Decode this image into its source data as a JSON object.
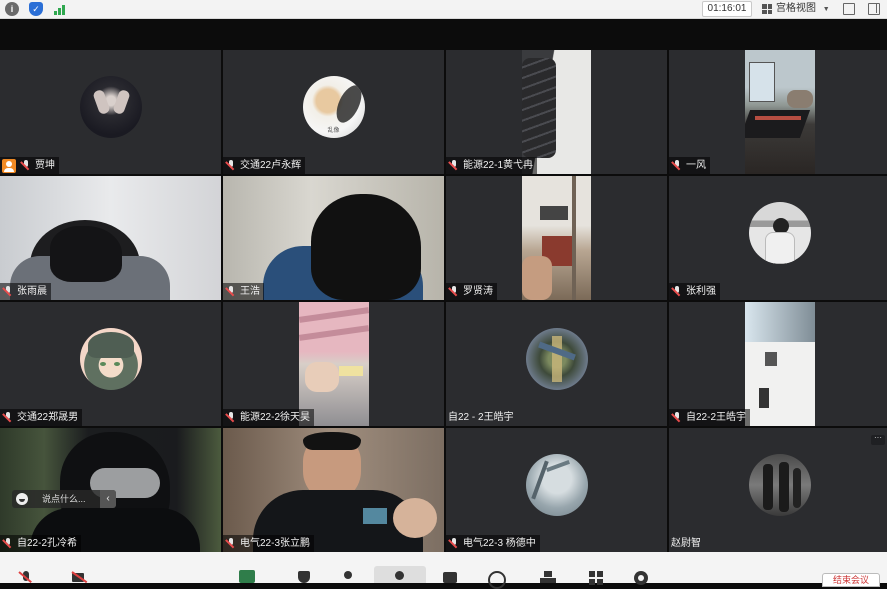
{
  "toolbar": {
    "timer": "01:16:01",
    "view_mode": "宫格视图"
  },
  "participants": [
    {
      "name": "贾坤",
      "host": true
    },
    {
      "name": "交通22卢永辉"
    },
    {
      "name": "能源22-1黄弋冉"
    },
    {
      "name": "一风"
    },
    {
      "name": "张雨晨"
    },
    {
      "name": "王浩"
    },
    {
      "name": "罗贤涛"
    },
    {
      "name": "张利强"
    },
    {
      "name": "交通22郑晟男"
    },
    {
      "name": "能源22-2徐天昊"
    },
    {
      "name": "自22 - 2王皓宇"
    },
    {
      "name": "自22-2王皓宇"
    },
    {
      "name": "自22-2孔冷希"
    },
    {
      "name": "电气22-3张立鹏"
    },
    {
      "name": "电气22-3 杨德中"
    },
    {
      "name": "赵尉智"
    }
  ],
  "chat_overlay": {
    "placeholder": "说点什么..."
  },
  "avatar_labels": {
    "tile2": "乱像"
  },
  "bottombar": {
    "leave_label": "结束会议"
  }
}
